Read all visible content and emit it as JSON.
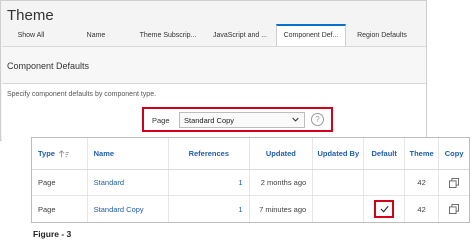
{
  "page": {
    "title": "Theme",
    "tabs": [
      {
        "label": "Show All"
      },
      {
        "label": "Name"
      },
      {
        "label": "Theme Subscrip..."
      },
      {
        "label": "JavaScript and ..."
      },
      {
        "label": "Component Def..."
      },
      {
        "label": "Region Defaults"
      }
    ],
    "active_tab": "Component Def...",
    "section": {
      "title": "Component Defaults",
      "description": "Specify component defaults by component type.",
      "page_label": "Page",
      "page_select_value": "Standard Copy",
      "help_glyph": "?"
    }
  },
  "table": {
    "columns": [
      {
        "label": "Type"
      },
      {
        "label": "Name"
      },
      {
        "label": "References"
      },
      {
        "label": "Updated"
      },
      {
        "label": "Updated By"
      },
      {
        "label": "Default"
      },
      {
        "label": "Theme"
      },
      {
        "label": "Copy"
      }
    ],
    "rows": [
      {
        "type": "Page",
        "name": "Standard",
        "references": "1",
        "updated": "2 months ago",
        "updated_by": "",
        "default": false,
        "theme": "42"
      },
      {
        "type": "Page",
        "name": "Standard Copy",
        "references": "1",
        "updated": "7 minutes ago",
        "updated_by": "",
        "default": true,
        "theme": "42"
      }
    ]
  },
  "caption": "Figure - 3",
  "icons": {
    "sort": "sort-ascending-icon",
    "chevron": "chevron-down-icon",
    "help": "help-icon",
    "check": "checkmark-icon",
    "copy": "copy-icon"
  },
  "colors": {
    "link": "#1f5ea8",
    "highlight": "#d0021b",
    "active_tab": "#0572ce"
  }
}
